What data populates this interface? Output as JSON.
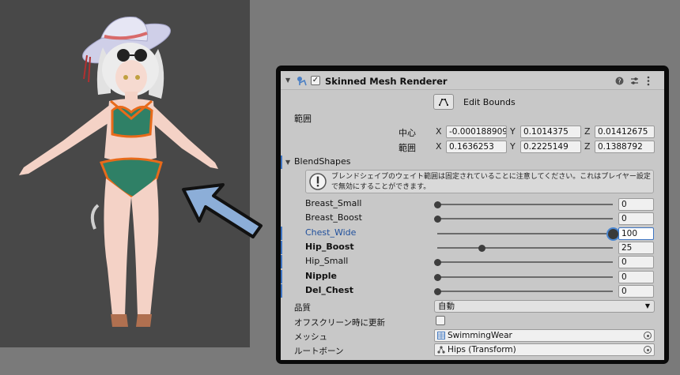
{
  "header": {
    "title": "Skinned Mesh Renderer",
    "check": "✓",
    "icons": [
      "help-icon",
      "sliders-icon",
      "kebab-menu-icon"
    ]
  },
  "bounds": {
    "edit_label": "Edit Bounds",
    "section_label": "範囲",
    "center_label": "中心",
    "extent_label": "範囲",
    "center": {
      "x": "-0.000188909",
      "y": "0.1014375",
      "z": "0.01412675"
    },
    "extent": {
      "x": "0.1636253",
      "y": "0.2225149",
      "z": "0.1388792"
    },
    "axis_x": "X",
    "axis_y": "Y",
    "axis_z": "Z"
  },
  "blendshapes": {
    "title": "BlendShapes",
    "warning": "ブレンドシェイプのウェイト範囲は固定されていることに注意してください。これはプレイヤー設定で無効にすることができます。",
    "items": [
      {
        "name": "Breast_Small",
        "value": 0,
        "display": "0",
        "bold": false,
        "selected": false,
        "modified": false
      },
      {
        "name": "Breast_Boost",
        "value": 0,
        "display": "0",
        "bold": false,
        "selected": false,
        "modified": false
      },
      {
        "name": "Chest_Wide",
        "value": 100,
        "display": "100",
        "bold": false,
        "selected": true,
        "modified": true
      },
      {
        "name": "Hip_Boost",
        "value": 25,
        "display": "25",
        "bold": true,
        "selected": false,
        "modified": true
      },
      {
        "name": "Hip_Small",
        "value": 0,
        "display": "0",
        "bold": false,
        "selected": false,
        "modified": true
      },
      {
        "name": "Nipple",
        "value": 0,
        "display": "0",
        "bold": true,
        "selected": false,
        "modified": true
      },
      {
        "name": "Del_Chest",
        "value": 0,
        "display": "0",
        "bold": true,
        "selected": false,
        "modified": true
      }
    ]
  },
  "props": {
    "quality_label": "品質",
    "quality_value": "自動",
    "offscreen_label": "オフスクリーン時に更新",
    "offscreen_checked": false,
    "mesh_label": "メッシュ",
    "mesh_value": "SwimmingWear",
    "rootbone_label": "ルートボーン",
    "rootbone_value": "Hips (Transform)"
  },
  "colors": {
    "accent_blue": "#3d74c2",
    "arrow_blue": "#8caed8",
    "outline_orange": "#e86a1a",
    "swimsuit_green": "#2f8066"
  }
}
